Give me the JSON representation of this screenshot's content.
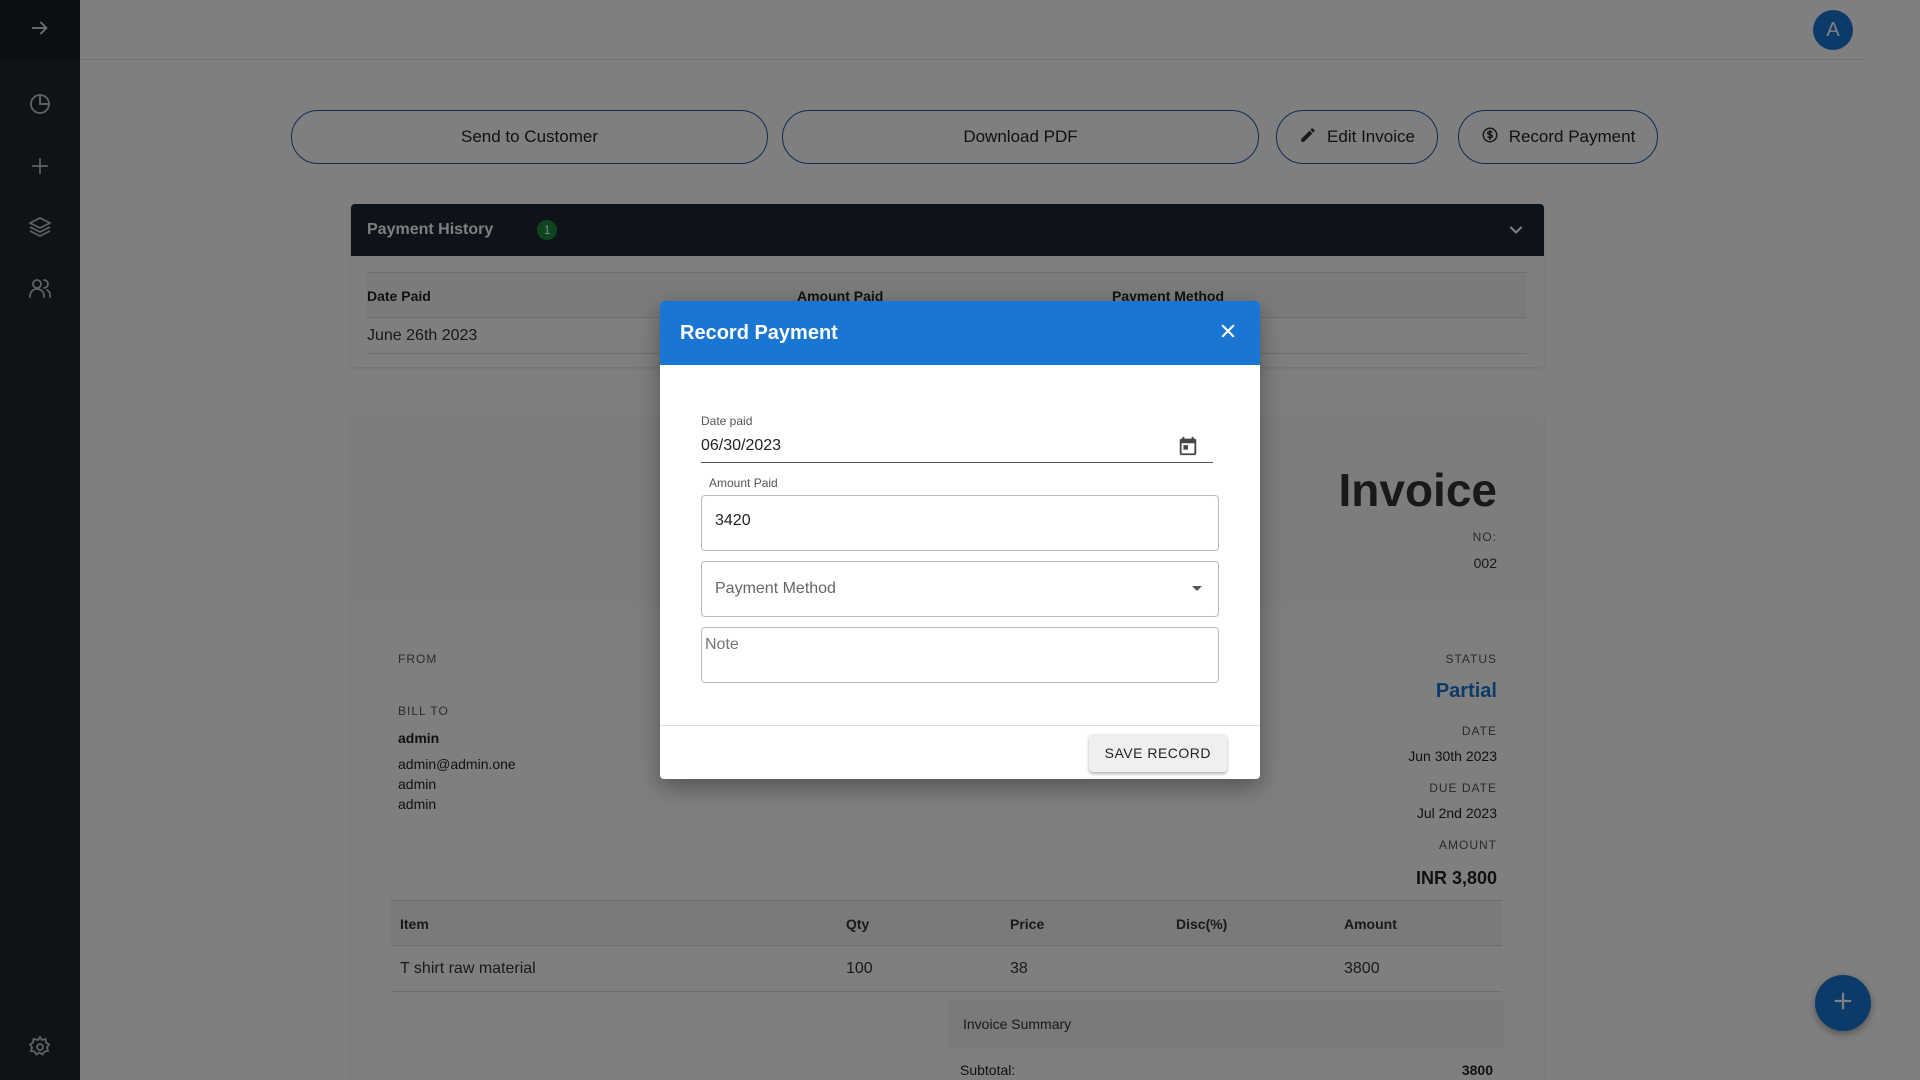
{
  "header": {
    "avatar_initial": "A"
  },
  "sidebar": {
    "items": [
      {
        "icon": "arrow-right-icon"
      },
      {
        "icon": "pie-chart-icon"
      },
      {
        "icon": "plus-icon"
      },
      {
        "icon": "layers-icon"
      },
      {
        "icon": "users-icon"
      },
      {
        "icon": "gear-icon"
      }
    ]
  },
  "actions": {
    "send": "Send to Customer",
    "download": "Download PDF",
    "edit": "Edit Invoice",
    "record": "Record Payment"
  },
  "payment_history": {
    "title": "Payment History",
    "count": "1",
    "columns": [
      "Date Paid",
      "Amount Paid",
      "Payment Method"
    ],
    "rows": [
      {
        "date": "June 26th 2023"
      }
    ]
  },
  "invoice": {
    "title": "Invoice",
    "no_label": "NO:",
    "number": "002",
    "from_label": "FROM",
    "bill_to_label": "BILL TO",
    "bill_to": {
      "name": "admin",
      "email": "admin@admin.one",
      "line1": "admin",
      "line2": "admin"
    },
    "status_label": "STATUS",
    "status": "Partial",
    "date_label": "DATE",
    "date": "Jun 30th 2023",
    "due_date_label": "DUE DATE",
    "due_date": "Jul 2nd 2023",
    "amount_label": "AMOUNT",
    "amount": "INR 3,800",
    "item_columns": [
      "Item",
      "Qty",
      "Price",
      "Disc(%)",
      "Amount"
    ],
    "items": [
      {
        "item": "T shirt raw material",
        "qty": "100",
        "price": "38",
        "disc": "",
        "amount": "3800"
      }
    ],
    "summary_title": "Invoice Summary",
    "subtotal_label": "Subtotal:",
    "subtotal": "3800"
  },
  "dialog": {
    "title": "Record Payment",
    "date_label": "Date paid",
    "date_value": "06/30/2023",
    "amount_label": "Amount Paid",
    "amount_value": "3420",
    "method_placeholder": "Payment Method",
    "note_placeholder": "Note",
    "save_label": "SAVE RECORD"
  },
  "colors": {
    "primary": "#1976d2",
    "sidebar": "#1d2631",
    "history_header": "#1c2734",
    "badge": "#1d8a3a",
    "status": "#1976d2"
  }
}
